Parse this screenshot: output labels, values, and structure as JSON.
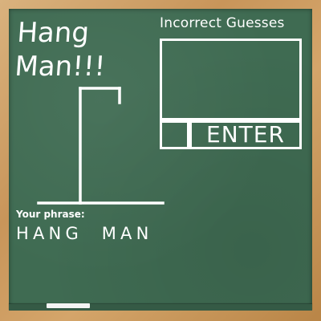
{
  "title": {
    "line1": "Hang",
    "line2": "Man!!!"
  },
  "incorrect": {
    "label": "Incorrect Guesses",
    "letters": ""
  },
  "guess": {
    "value": "",
    "placeholder": ""
  },
  "enter": {
    "label": "ENTER"
  },
  "phrase": {
    "label": "Your phrase:",
    "text": "HANG  MAN"
  },
  "colors": {
    "board": "#3f6b52",
    "chalk": "#ffffff",
    "frame": "#c8955a"
  },
  "icons": {
    "gallows": "gallows-icon",
    "chalk": "chalk-stick-icon"
  }
}
